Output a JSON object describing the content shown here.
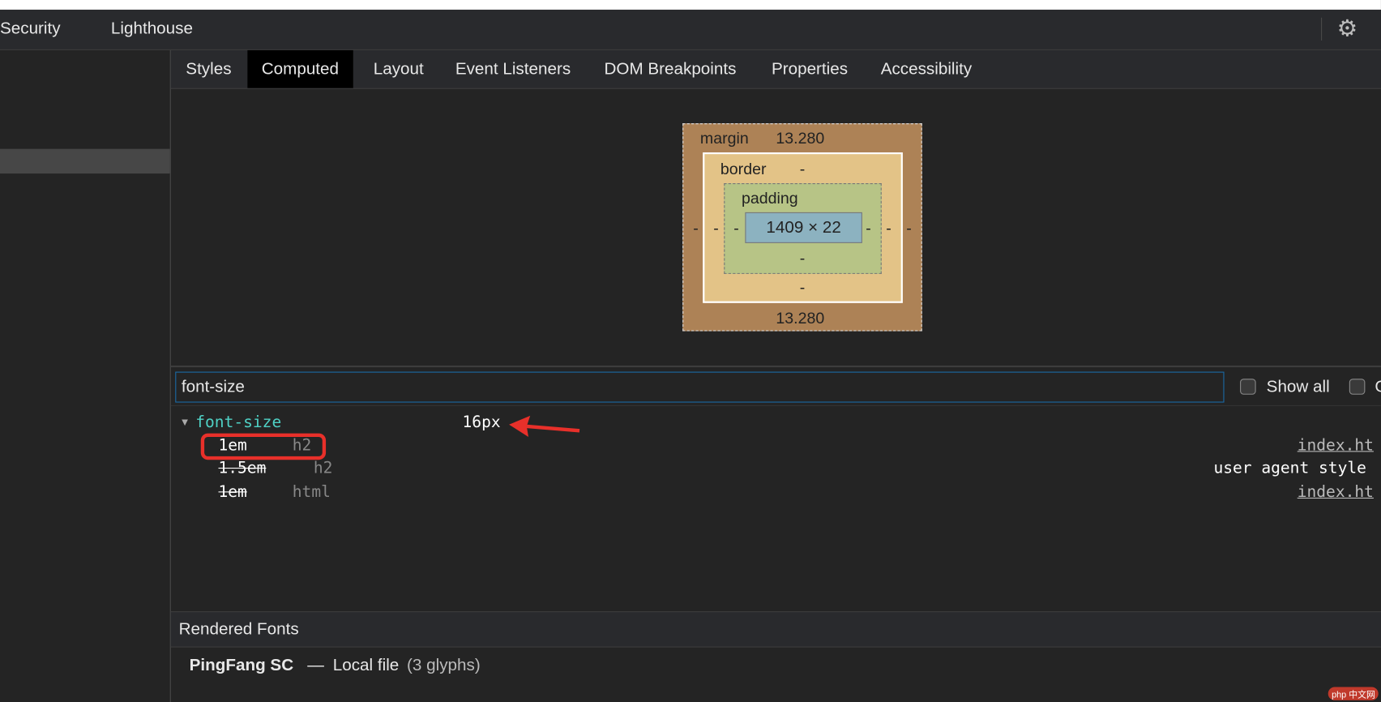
{
  "toolbar": {
    "tabs": [
      "Security",
      "Lighthouse"
    ],
    "settings_icon": "gear-icon"
  },
  "sidebar_tabs": [
    "Styles",
    "Computed",
    "Layout",
    "Event Listeners",
    "DOM Breakpoints",
    "Properties",
    "Accessibility"
  ],
  "active_tab": "Computed",
  "box_model": {
    "margin_label": "margin",
    "margin_top": "13.280",
    "margin_bottom": "13.280",
    "margin_left": "-",
    "margin_right": "-",
    "border_label": "border",
    "border_top": "-",
    "border_bottom": "-",
    "border_left": "-",
    "border_right": "-",
    "padding_label": "padding",
    "padding_top": "",
    "padding_bottom": "-",
    "padding_left": "-",
    "padding_right": "-",
    "content": "1409 × 22",
    "colors": {
      "margin": "#ad8256",
      "border": "#e3c387",
      "padding": "#b7c486",
      "content": "#8cb2c0"
    }
  },
  "filter": {
    "value": "font-size"
  },
  "checkboxes": {
    "show_all": "Show all",
    "group": "G"
  },
  "property": {
    "name": "font-size",
    "value": "16px",
    "rules": [
      {
        "value": "1em",
        "selector": "h2",
        "source": "index.ht",
        "overridden": false,
        "source_link": true
      },
      {
        "value": "1.5em",
        "selector": "h2",
        "source": "user agent style",
        "overridden": true,
        "source_link": false
      },
      {
        "value": "1em",
        "selector": "html",
        "source": "index.ht",
        "overridden": true,
        "source_link": true
      }
    ]
  },
  "rendered_fonts": {
    "title": "Rendered Fonts",
    "font": "PingFang SC",
    "dash": "—",
    "source": "Local file",
    "glyphs": "(3 glyphs)"
  },
  "annotation_color": "#e8302a",
  "watermark": "php 中文网"
}
